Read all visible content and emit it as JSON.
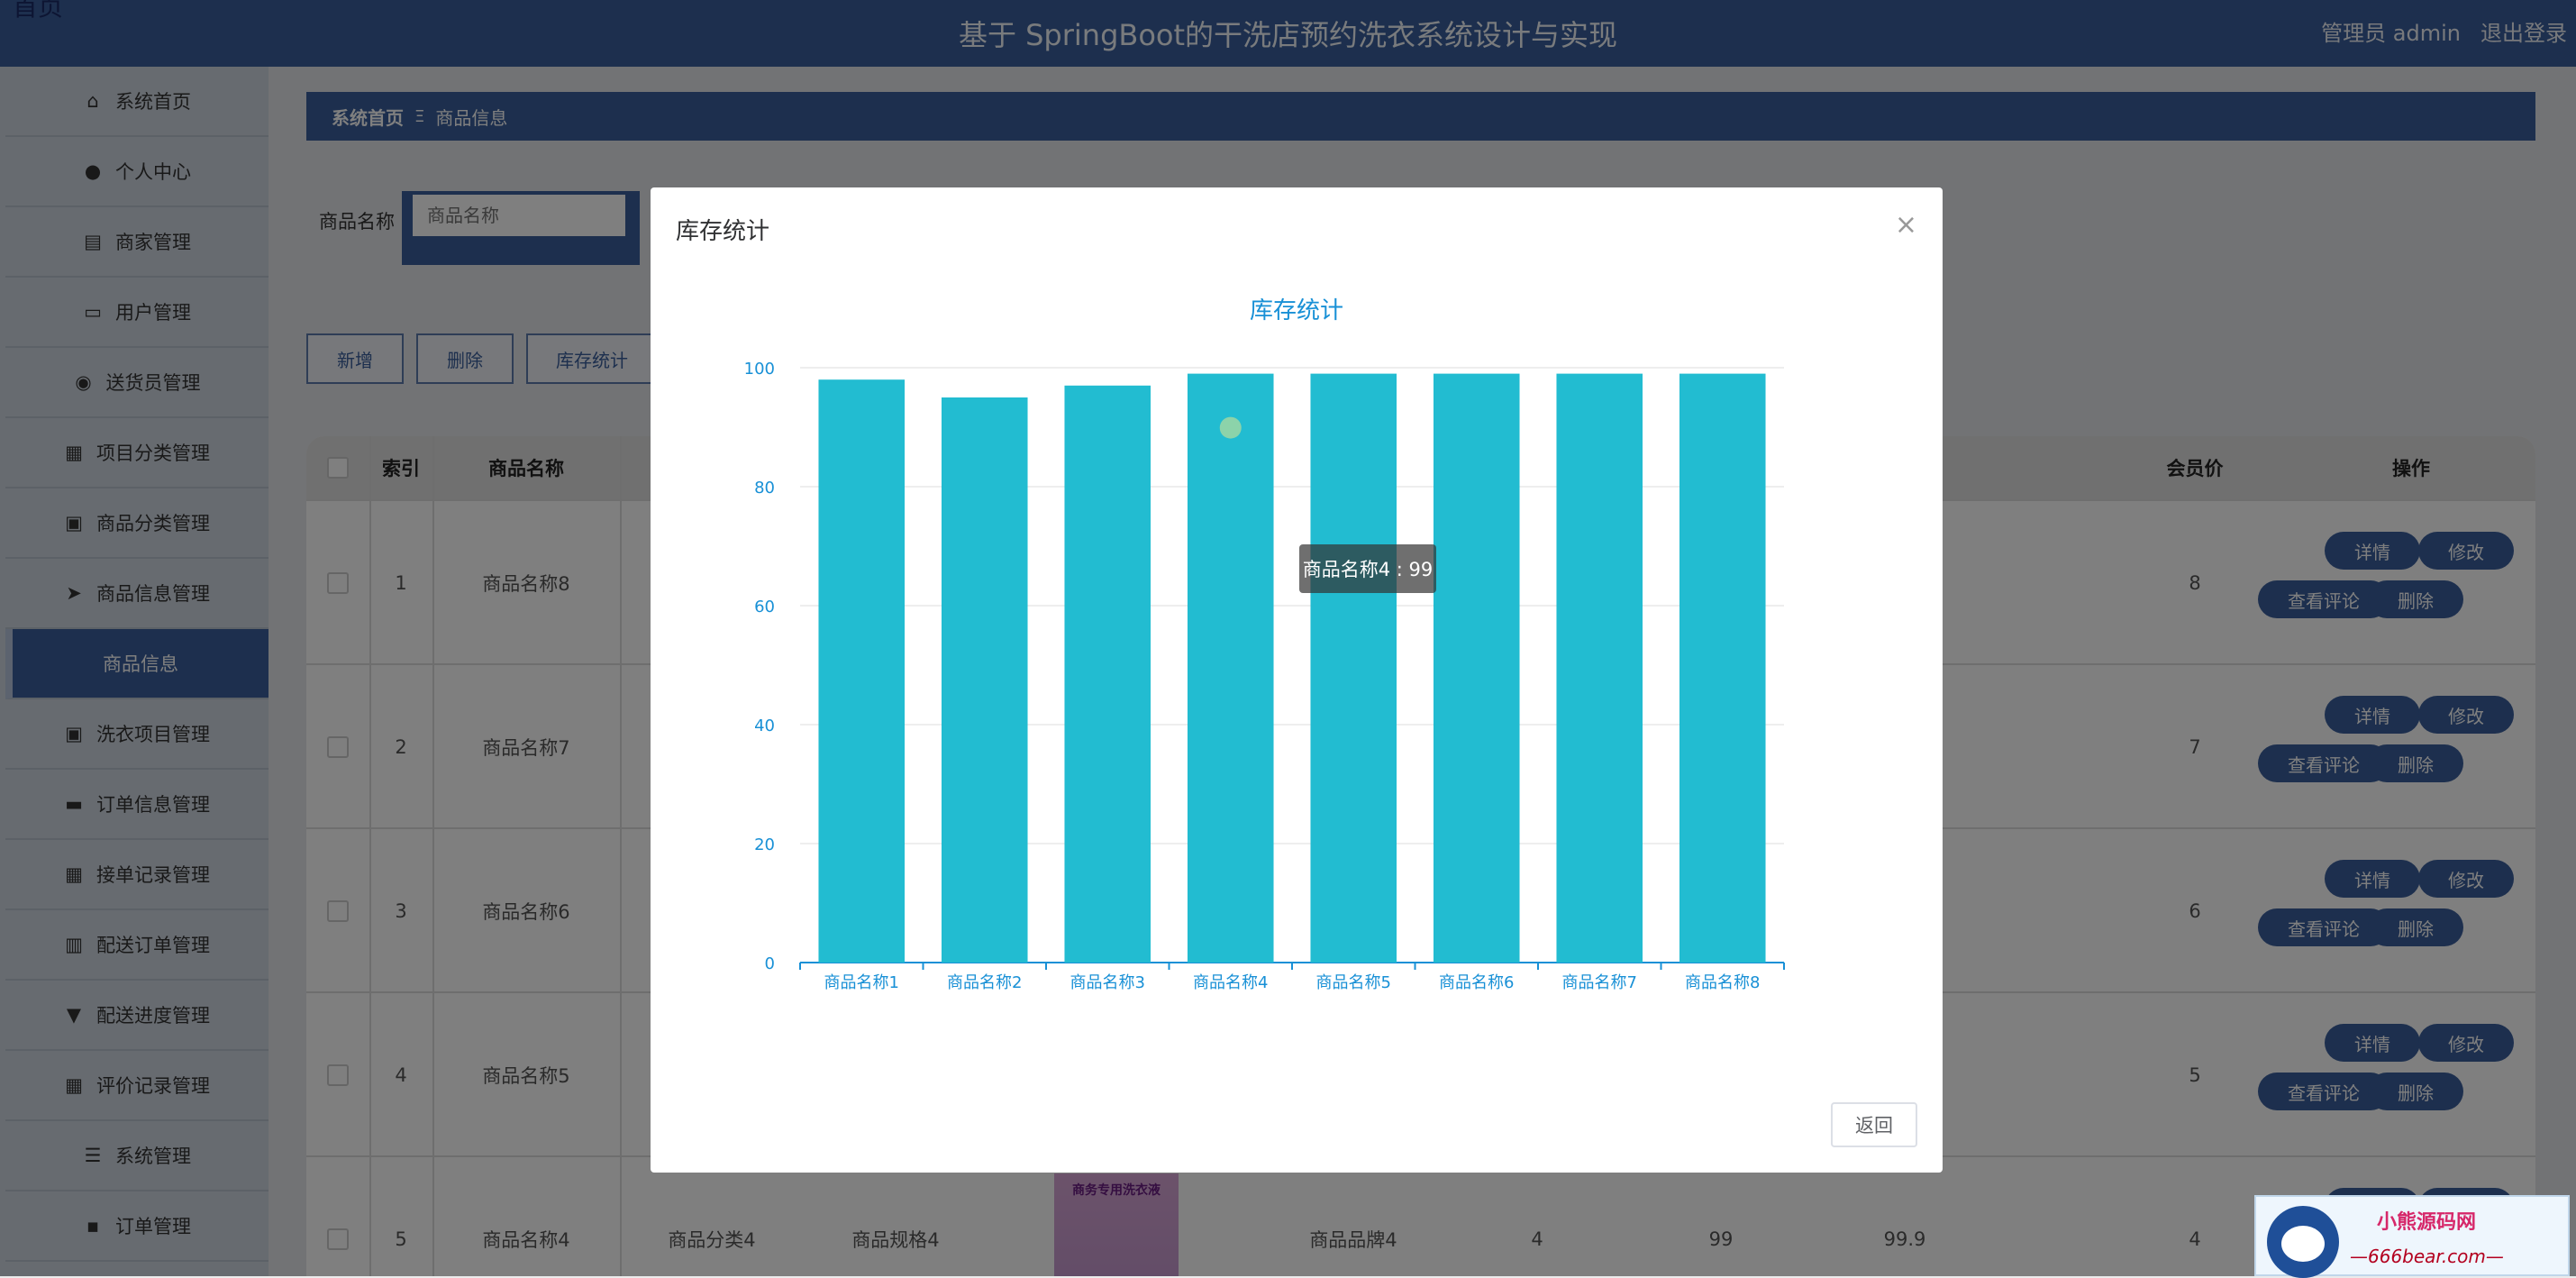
{
  "header": {
    "corner_text": "首页",
    "title": "基于 SpringBoot的干洗店预约洗衣系统设计与实现",
    "user": "管理员 admin",
    "logout": "退出登录"
  },
  "sidebar": {
    "items": [
      {
        "label": "系统首页",
        "icon": "home-icon"
      },
      {
        "label": "个人中心",
        "icon": "user-icon"
      },
      {
        "label": "商家管理",
        "icon": "chart-icon"
      },
      {
        "label": "用户管理",
        "icon": "monitor-icon"
      },
      {
        "label": "送货员管理",
        "icon": "location-icon"
      },
      {
        "label": "项目分类管理",
        "icon": "grid-icon"
      },
      {
        "label": "商品分类管理",
        "icon": "clipboard-icon"
      },
      {
        "label": "商品信息管理",
        "icon": "send-icon"
      },
      {
        "label": "商品信息",
        "icon": "",
        "active": true
      },
      {
        "label": "洗衣项目管理",
        "icon": "clipboard-check-icon"
      },
      {
        "label": "订单信息管理",
        "icon": "briefcase-icon"
      },
      {
        "label": "接单记录管理",
        "icon": "grid-icon"
      },
      {
        "label": "配送订单管理",
        "icon": "bars-icon"
      },
      {
        "label": "配送进度管理",
        "icon": "podium-icon"
      },
      {
        "label": "评价记录管理",
        "icon": "grid-icon"
      },
      {
        "label": "系统管理",
        "icon": "sliders-icon"
      },
      {
        "label": "订单管理",
        "icon": "chat-icon"
      }
    ]
  },
  "breadcrumb": {
    "home": "系统首页",
    "sep": "Ξ",
    "current": "商品信息"
  },
  "search": {
    "label": "商品名称",
    "placeholder": "商品名称"
  },
  "actions": {
    "add": "新增",
    "delete": "删除",
    "stats": "库存统计"
  },
  "table": {
    "headers": {
      "index": "索引",
      "name": "商品名称",
      "member_price": "会员价",
      "ops": "操作"
    },
    "rows": [
      {
        "index": "1",
        "name": "商品名称8",
        "member_price": "8"
      },
      {
        "index": "2",
        "name": "商品名称7",
        "member_price": "7"
      },
      {
        "index": "3",
        "name": "商品名称6",
        "member_price": "6"
      },
      {
        "index": "4",
        "name": "商品名称5",
        "member_price": "5"
      },
      {
        "index": "5",
        "name": "商品名称4",
        "category": "商品分类4",
        "spec": "商品规格4",
        "brand": "商品品牌4",
        "c1": "4",
        "c2": "99",
        "c3": "99.9",
        "member_price": "4"
      }
    ],
    "op_labels": {
      "detail": "详情",
      "edit": "修改",
      "comments": "查看评论",
      "remove": "删除"
    },
    "thumb_text": "商务专用洗衣液"
  },
  "modal": {
    "title": "库存统计",
    "close": "×",
    "back": "返回",
    "tooltip": "商品名称4 : 99"
  },
  "chart_data": {
    "type": "bar",
    "title": "库存统计",
    "categories": [
      "商品名称1",
      "商品名称2",
      "商品名称3",
      "商品名称4",
      "商品名称5",
      "商品名称6",
      "商品名称7",
      "商品名称8"
    ],
    "values": [
      98,
      95,
      97,
      99,
      99,
      99,
      99,
      99
    ],
    "ylim": [
      0,
      100
    ],
    "yticks": [
      0,
      20,
      40,
      60,
      80,
      100
    ],
    "bar_color": "#22bcd1",
    "axis_color": "#1890d6"
  },
  "watermark": {
    "line1": "小熊源码网",
    "line2": "—666bear.com—"
  }
}
